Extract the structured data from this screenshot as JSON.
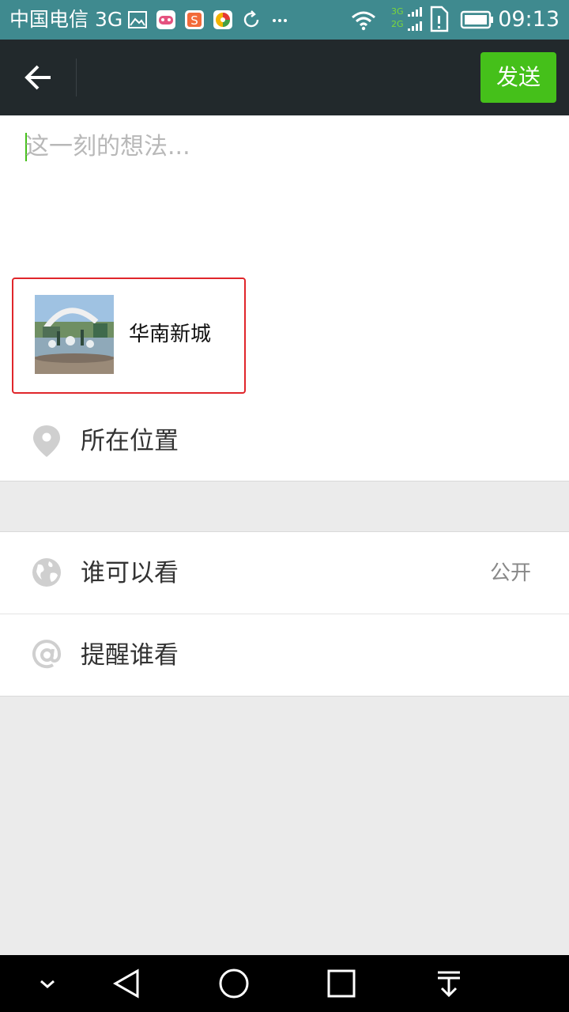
{
  "status_bar": {
    "carrier": "中国电信 3G",
    "time": "09:13",
    "icons": [
      "image-icon",
      "game-icon",
      "sogou-icon",
      "browser-icon",
      "sync-icon",
      "more-icon",
      "wifi-icon",
      "signal-3g-2g-icon",
      "sim-icon",
      "battery-icon"
    ]
  },
  "titlebar": {
    "back_icon": "arrow-left-icon",
    "send_label": "发送"
  },
  "compose": {
    "placeholder": "这一刻的想法...",
    "shared_item": {
      "title": "华南新城",
      "thumbnail": "fountain-photo"
    },
    "location": {
      "icon": "map-pin-icon",
      "label": "所在位置"
    }
  },
  "settings": [
    {
      "icon": "globe-icon",
      "label": "谁可以看",
      "value": "公开"
    },
    {
      "icon": "at-icon",
      "label": "提醒谁看",
      "value": ""
    }
  ],
  "navbar": {
    "items": [
      "chevron-down-icon",
      "back-triangle-icon",
      "home-circle-icon",
      "recents-square-icon",
      "notification-pull-icon"
    ]
  },
  "colors": {
    "status_bar": "#3f8a8f",
    "title_bar": "#22292c",
    "send_button": "#45c01a",
    "highlight_border": "#e0262b"
  }
}
